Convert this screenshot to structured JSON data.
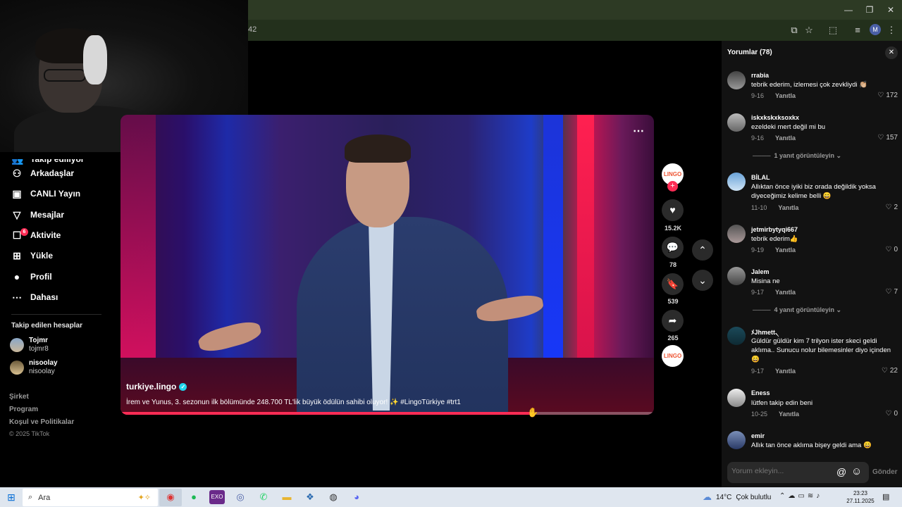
{
  "browser": {
    "url_fragment": "42",
    "window_controls": [
      "minimize",
      "restore",
      "close"
    ],
    "toolbar_icons": [
      "install-icon",
      "star-icon",
      "extensions-icon",
      "media-icon",
      "profile-icon",
      "menu-icon"
    ],
    "profile_initial": "M"
  },
  "sidebar": {
    "items": [
      {
        "label": "Takip ediliyor",
        "icon": "following-icon"
      },
      {
        "label": "Arkadaşlar",
        "icon": "friends-icon"
      },
      {
        "label": "CANLI Yayın",
        "icon": "live-icon"
      },
      {
        "label": "Mesajlar",
        "icon": "messages-icon"
      },
      {
        "label": "Aktivite",
        "icon": "activity-icon",
        "badge": "6"
      },
      {
        "label": "Yükle",
        "icon": "upload-icon"
      },
      {
        "label": "Profil",
        "icon": "profile-icon"
      },
      {
        "label": "Dahası",
        "icon": "more-icon"
      }
    ],
    "followed_title": "Takip edilen hesaplar",
    "followed": [
      {
        "name": "Tojmr",
        "handle": "tojmr8"
      },
      {
        "name": "nisoolay",
        "handle": "nisoolay"
      }
    ],
    "footer": [
      "Şirket",
      "Program",
      "Koşul ve Politikalar"
    ],
    "copyright": "© 2025 TikTok"
  },
  "video": {
    "author": "turkiye.lingo",
    "caption": "İrem ve Yunus, 3. sezonun ilk bölümünde 248.700 TL'lik büyük ödülün sahibi oluyor! ✨ #LingoTürkiye #trt1",
    "progress": 0.77,
    "accent": "#fe2c55"
  },
  "actions": {
    "likes": "15.2K",
    "comments": "78",
    "saves": "539",
    "shares": "265",
    "logo_text": "LINGO"
  },
  "comments": {
    "title": "Yorumlar (78)",
    "reply_label": "Yanıtla",
    "items": [
      {
        "user": "rrabia",
        "text": "tebrik ederim, izlemesi çok zevkliydi 👏🏼",
        "date": "9-16",
        "likes": "172"
      },
      {
        "user": "iskxkskxksoxkx",
        "text": "ezeldeki mert değil mi bu",
        "date": "9-16",
        "likes": "157",
        "more": "1 yanıt görüntüleyin"
      },
      {
        "user": "BİLAL",
        "text": "Allıktan önce iyiki biz orada değildik yoksa diyeceğimiz kelime belli 😄",
        "date": "11-10",
        "likes": "2"
      },
      {
        "user": "jetmirbytyqi667",
        "text": "tebrik ederim👍",
        "date": "9-19",
        "likes": "0"
      },
      {
        "user": "Jalem",
        "text": "Misina ne",
        "date": "9-17",
        "likes": "7",
        "more": "4 yanıt görüntüleyin"
      },
      {
        "user": "ﾒJhmett৲",
        "text": "Güldür güldür kim 7 trilyon ister skeci geldi aklıma.. Sunucu nolur bilemesinler diyo içinden 😄",
        "date": "9-17",
        "likes": "22"
      },
      {
        "user": "Eness",
        "text": "lütfen takip edin beni",
        "date": "10-25",
        "likes": "0"
      },
      {
        "user": "emir",
        "text": "Allık tan önce aklıma bişey geldi ama 😄",
        "date": "",
        "likes": ""
      }
    ],
    "input_placeholder": "Yorum ekleyin...",
    "send_label": "Gönder"
  },
  "taskbar": {
    "search_placeholder": "Ara",
    "weather_temp": "14°C",
    "weather_text": "Çok bulutlu",
    "time": "23:23",
    "date": "27.11.2025"
  }
}
